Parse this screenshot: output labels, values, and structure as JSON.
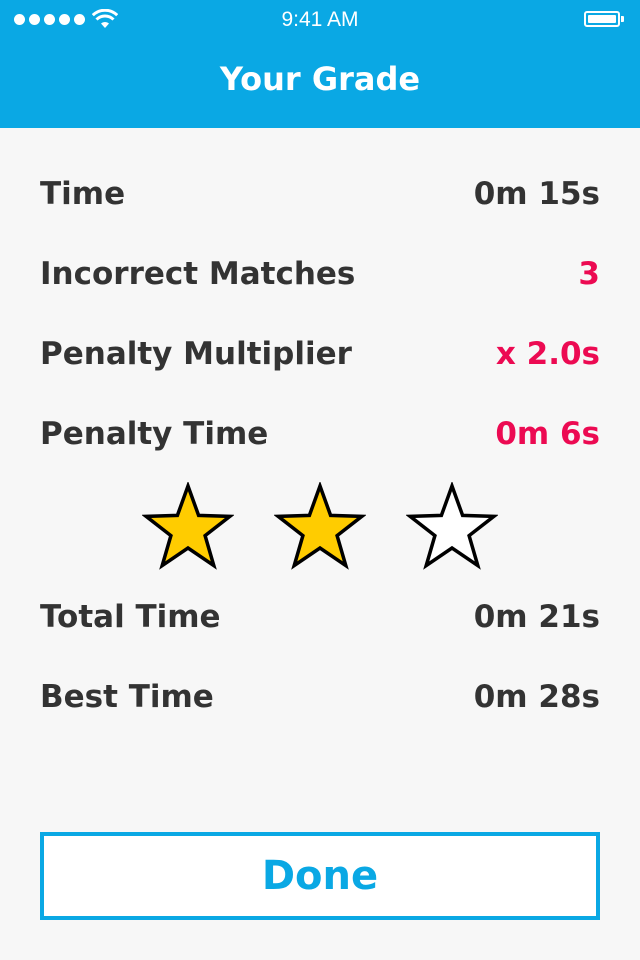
{
  "status_bar": {
    "time": "9:41 AM",
    "signal_icon": "cellular-signal-dots",
    "wifi_icon": "wifi-icon",
    "battery_icon": "battery-full-icon"
  },
  "header": {
    "title": "Your Grade",
    "background_color": "#0aa8e4"
  },
  "results": [
    {
      "label": "Time",
      "value": "0m 15s",
      "penalty": false
    },
    {
      "label": "Incorrect Matches",
      "value": "3",
      "penalty": true
    },
    {
      "label": "Penalty Multiplier",
      "value": "x 2.0s",
      "penalty": true
    },
    {
      "label": "Penalty Time",
      "value": "0m 6s",
      "penalty": true
    }
  ],
  "rating": {
    "stars_earned": 2,
    "stars_total": 3,
    "filled_color": "#ffcc00",
    "empty_color": "#ffffff"
  },
  "totals": [
    {
      "label": "Total Time",
      "value": "0m 21s"
    },
    {
      "label": "Best Time",
      "value": "0m 28s"
    }
  ],
  "done_button": {
    "label": "Done",
    "color": "#0aa8e4"
  },
  "colors": {
    "penalty_text": "#ec0a52",
    "body_text": "#333333",
    "background": "#f7f7f7"
  }
}
